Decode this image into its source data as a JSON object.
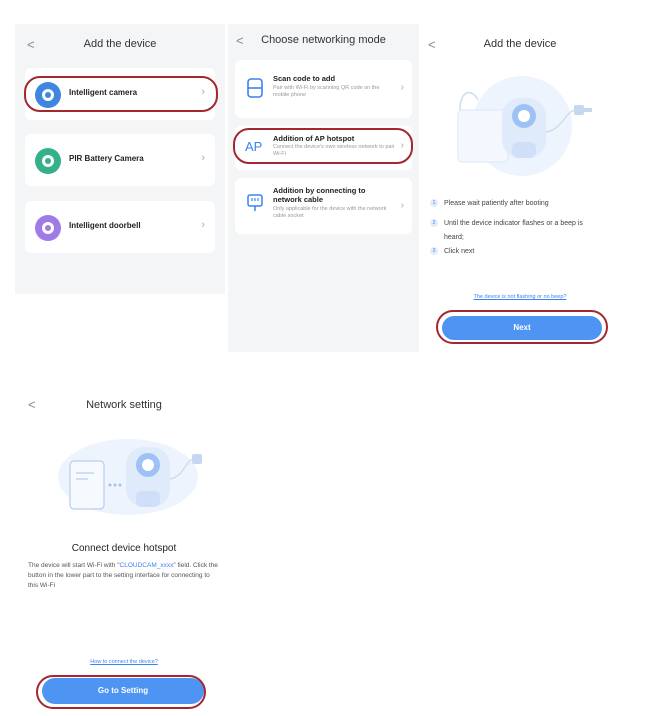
{
  "panel1": {
    "back": "<",
    "title": "Add the device",
    "items": [
      {
        "label": "Intelligent camera",
        "icon": "camera-icon",
        "color": "#3f86e0"
      },
      {
        "label": "PIR Battery Camera",
        "icon": "camera-icon",
        "color": "#34b08c"
      },
      {
        "label": "Intelligent doorbell",
        "icon": "doorbell-icon",
        "color": "#a07ae6"
      }
    ]
  },
  "panel2": {
    "back": "<",
    "title": "Choose networking mode",
    "options": [
      {
        "title": "Scan code to add",
        "subtitle": "Pair with Wi-Fi by scanning QR code on the mobile phone",
        "icon": "qr-scan-icon"
      },
      {
        "title": "Addition of AP hotspot",
        "subtitle": "Connect the device's own wireless network to pair Wi-Fi",
        "icon": "ap-hotspot-icon",
        "icon_text": "AP"
      },
      {
        "title": "Addition by connecting to network cable",
        "subtitle": "Only applicable for the device with the network cable socket",
        "icon": "ethernet-icon"
      }
    ]
  },
  "panel3": {
    "back": "<",
    "title": "Add the device",
    "steps": [
      {
        "num": "1",
        "text": "Please wait patiently after booting"
      },
      {
        "num": "2",
        "text": "Until the device indicator flashes or a beep is"
      },
      {
        "num": "",
        "text": "heard;"
      },
      {
        "num": "3",
        "text": "Click next"
      }
    ],
    "link": "The device is not flashing or no beep?",
    "button": "Next"
  },
  "panel4": {
    "back": "<",
    "title": "Network setting",
    "heading": "Connect device hotspot",
    "desc_before": "The device will start Wi-Fi with \"",
    "ssid": "CLOUDCAM_xxxx",
    "desc_after": "\" field. Click the button in the lower part to the setting interface for connecting to this Wi-Fi",
    "link": "How to connect the device?",
    "button": "Go to Setting"
  },
  "colors": {
    "accent": "#4d94f3",
    "highlight_ring": "#a3272f",
    "link": "#3b82f6"
  }
}
